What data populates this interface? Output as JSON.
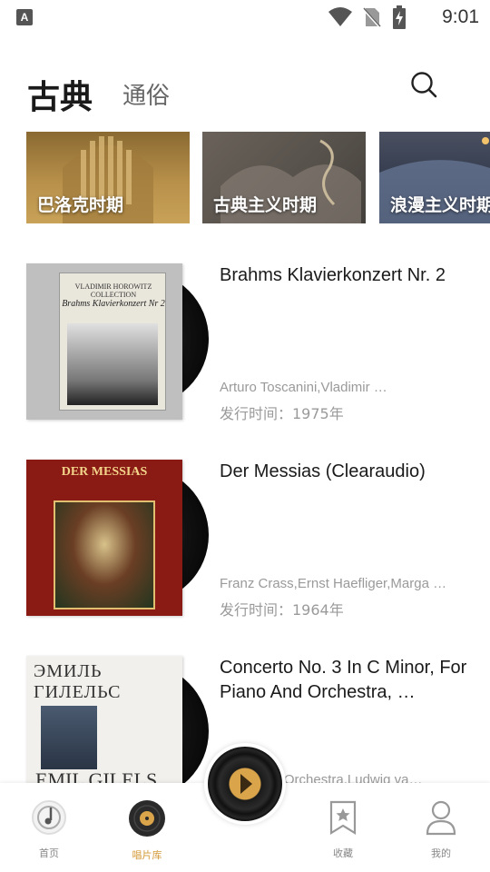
{
  "status_bar": {
    "time": "9:01",
    "app_icon": "A"
  },
  "header": {
    "tabs": [
      {
        "label": "古典",
        "active": true
      },
      {
        "label": "通俗",
        "active": false
      }
    ],
    "search_icon": "search-icon"
  },
  "categories": [
    {
      "label": "巴洛克时期"
    },
    {
      "label": "古典主义时期"
    },
    {
      "label": "浪漫主义时期"
    }
  ],
  "albums": [
    {
      "title": "Brahms Klavierkonzert Nr. 2",
      "artists": "Arturo Toscanini,Vladimir …",
      "release": "发行时间：1975年",
      "cover_text": [
        "VLADIMIR HOROWITZ COLLECTION",
        "Brahms Klavierkonzert Nr 2"
      ]
    },
    {
      "title": "Der Messias (Clearaudio)",
      "artists": "Franz Crass,Ernst Haefliger,Marga …",
      "release": "发行时间：1964年",
      "cover_text": [
        "DER MESSIAS"
      ]
    },
    {
      "title": "Concerto No. 3 In C Minor, For Piano And Orchestra, …",
      "artists": "Cleveland Orchestra,Ludwig va…",
      "release": "",
      "cover_text": [
        "ЭМИЛЬ ГИЛЕЛЬС",
        "EMIL GILELS"
      ]
    }
  ],
  "bottom_nav": [
    {
      "label": "首页",
      "icon": "music-note-icon",
      "active": false
    },
    {
      "label": "唱片库",
      "icon": "vinyl-icon",
      "active": true
    },
    {
      "label": "收藏",
      "icon": "bookmark-star-icon",
      "active": false
    },
    {
      "label": "我的",
      "icon": "user-icon",
      "active": false
    }
  ],
  "colors": {
    "accent": "#d49a3a",
    "tab_underline": "#f2c36b"
  }
}
